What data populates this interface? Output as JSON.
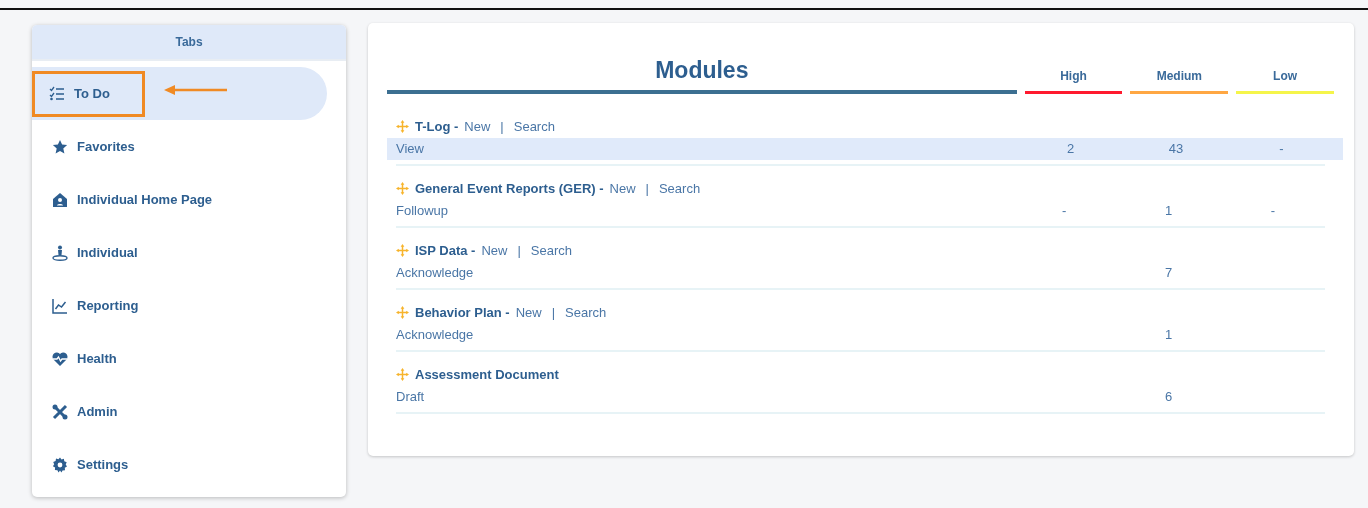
{
  "sidebar": {
    "title": "Tabs",
    "items": [
      {
        "label": "To Do",
        "kind": "todo",
        "selected": true,
        "highlighted": true
      },
      {
        "label": "Favorites",
        "kind": "star",
        "selected": false,
        "highlighted": false
      },
      {
        "label": "Individual Home Page",
        "kind": "home",
        "selected": false,
        "highlighted": false
      },
      {
        "label": "Individual",
        "kind": "person",
        "selected": false,
        "highlighted": false
      },
      {
        "label": "Reporting",
        "kind": "chart",
        "selected": false,
        "highlighted": false
      },
      {
        "label": "Health",
        "kind": "heart",
        "selected": false,
        "highlighted": false
      },
      {
        "label": "Admin",
        "kind": "tools",
        "selected": false,
        "highlighted": false
      },
      {
        "label": "Settings",
        "kind": "gear",
        "selected": false,
        "highlighted": false
      }
    ]
  },
  "modules": {
    "title": "Modules",
    "priorities": [
      {
        "label": "High",
        "color": "#ff1a2e"
      },
      {
        "label": "Medium",
        "color": "#ffa743"
      },
      {
        "label": "Low",
        "color": "#f5f54a"
      }
    ],
    "rows": [
      {
        "name": "T-Log -",
        "links": [
          "New",
          "Search"
        ],
        "separator": "|",
        "action": "View",
        "selected": true,
        "counts": {
          "high": "2",
          "medium": "43",
          "low": "-"
        }
      },
      {
        "name": "General Event Reports (GER) -",
        "links": [
          "New",
          "Search"
        ],
        "separator": "|",
        "action": "Followup",
        "selected": false,
        "counts": {
          "high": "-",
          "medium": "1",
          "low": "-"
        }
      },
      {
        "name": "ISP Data -",
        "links": [
          "New",
          "Search"
        ],
        "separator": "|",
        "action": "Acknowledge",
        "selected": false,
        "counts": {
          "medium": "7"
        }
      },
      {
        "name": "Behavior Plan -",
        "links": [
          "New",
          "Search"
        ],
        "separator": "|",
        "action": "Acknowledge",
        "selected": false,
        "counts": {
          "medium": "1"
        }
      },
      {
        "name": "Assessment Document",
        "action": "Draft",
        "selected": false,
        "counts": {
          "medium": "6"
        }
      }
    ]
  }
}
